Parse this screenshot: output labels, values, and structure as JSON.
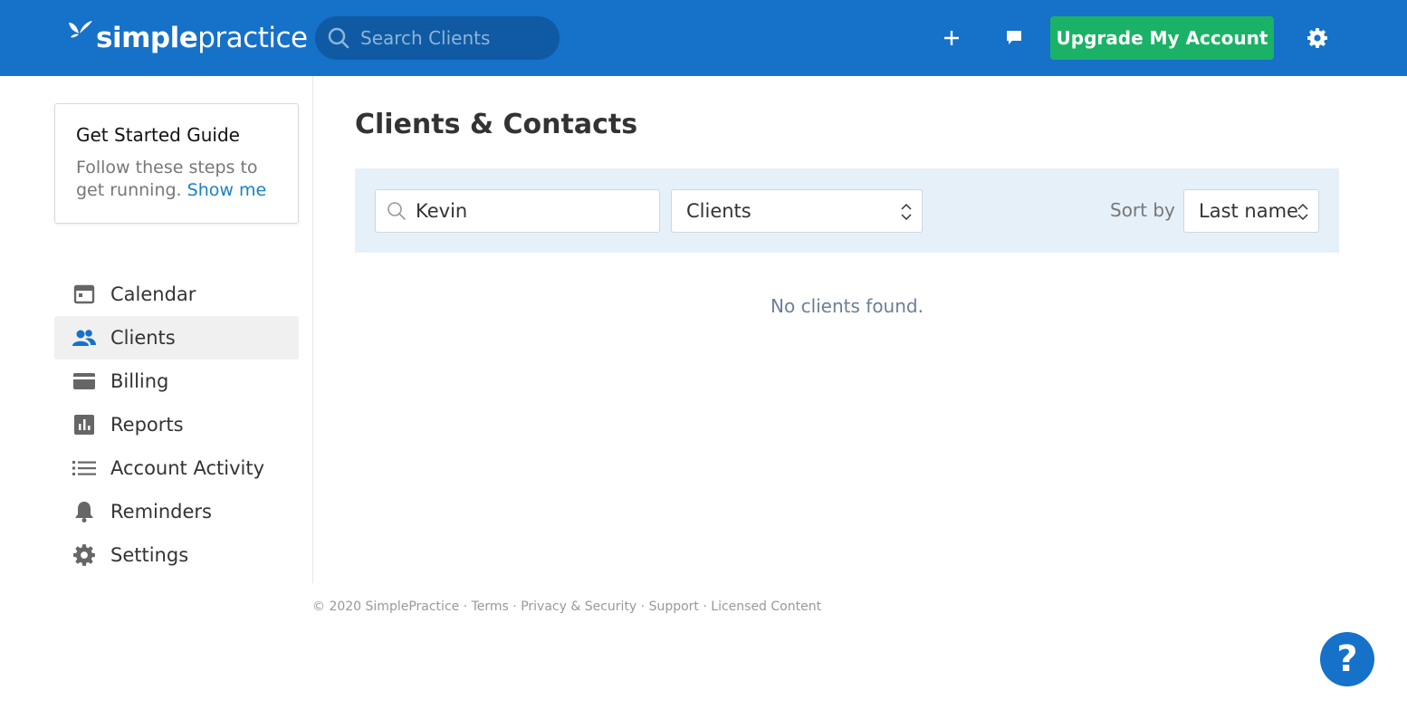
{
  "header": {
    "logo_text_bold": "simple",
    "logo_text_light": "practice",
    "search_placeholder": "Search Clients",
    "add_icon": "plus-icon",
    "messages_icon": "chat-bubble-icon",
    "upgrade_label": "Upgrade My Account",
    "settings_icon": "gear-icon",
    "colors": {
      "bar": "#1671c9",
      "search_bg": "#0f5aa3",
      "upgrade": "#1ab266"
    }
  },
  "guide": {
    "title": "Get Started Guide",
    "text": "Follow these steps to get running.",
    "link": "Show me"
  },
  "sidebar": {
    "items": [
      {
        "label": "Calendar",
        "icon": "calendar-icon",
        "active": false
      },
      {
        "label": "Clients",
        "icon": "people-icon",
        "active": true
      },
      {
        "label": "Billing",
        "icon": "credit-card-icon",
        "active": false
      },
      {
        "label": "Reports",
        "icon": "bar-chart-icon",
        "active": false
      },
      {
        "label": "Account Activity",
        "icon": "list-icon",
        "active": false
      },
      {
        "label": "Reminders",
        "icon": "bell-icon",
        "active": false
      },
      {
        "label": "Settings",
        "icon": "gear-icon",
        "active": false
      }
    ],
    "active_color": "#1671c9"
  },
  "main": {
    "title": "Clients & Contacts",
    "search_value": "Kevin",
    "type_select": "Clients",
    "sort_label": "Sort by",
    "sort_select": "Last name",
    "empty_message": "No clients found."
  },
  "footer": {
    "copyright": "© 2020 SimplePractice",
    "links": [
      "Terms",
      "Privacy & Security",
      "Support",
      "Licensed Content"
    ],
    "separator": " · "
  },
  "help": {
    "label": "?"
  }
}
